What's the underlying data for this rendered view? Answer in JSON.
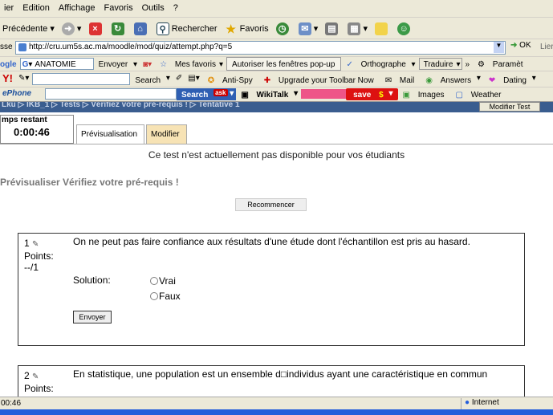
{
  "menu": [
    "ier",
    "Edition",
    "Affichage",
    "Favoris",
    "Outils",
    "?"
  ],
  "toolbar": {
    "back": "Précédente",
    "search": "Rechercher",
    "favorites": "Favoris"
  },
  "address": {
    "label": "sse",
    "url": "http://cru.um5s.ac.ma/moodle/mod/quiz/attempt.php?q=5",
    "go": "OK",
    "links": "Lier"
  },
  "google_bar": {
    "logo": "ogle",
    "search_value": "ANATOMIE",
    "send": "Envoyer",
    "bookmarks": "Mes favoris",
    "popups": "Autoriser les fenêtres pop-up",
    "spelling": "Orthographe",
    "translate": "Traduire",
    "settings": "Paramèt"
  },
  "yahoo_bar": {
    "logo": "Y!",
    "search": "Search",
    "antispy": "Anti-Spy",
    "upgrade": "Upgrade your Toolbar Now",
    "mail": "Mail",
    "answers": "Answers",
    "dating": "Dating"
  },
  "phone_bar": {
    "logo": "ePhone",
    "search": "Search",
    "wikitalk": "WikiTalk",
    "save": "save",
    "images": "Images",
    "weather": "Weather"
  },
  "page": {
    "breadcrumb": "Lku ▷ IKB_1 ▷ Tests ▷ Vérifiez votre pré-requis ! ▷ Tentative 1",
    "modify_test": "Modifier Test",
    "timer_label": "mps restant",
    "timer_value": "0:00:46",
    "tab_preview": "Prévisualisation",
    "tab_edit": "Modifier",
    "notice": "Ce test n'est actuellement pas disponible pour vos étudiants",
    "preview_title": "Prévisualiser Vérifiez votre pré-requis !",
    "restart": "Recommencer"
  },
  "questions": [
    {
      "num": "1",
      "points_label": "Points:",
      "points_value": "--/1",
      "text": "On ne peut pas faire confiance aux résultats d'une étude dont l'échantillon est pris au hasard.",
      "solution_label": "Solution:",
      "options": [
        "Vrai",
        "Faux"
      ],
      "submit": "Envoyer"
    },
    {
      "num": "2",
      "points_label": "Points:",
      "text": "En statistique, une population est un ensemble d□individus ayant une caractéristique en commun"
    }
  ],
  "status": {
    "left": "00:46",
    "zone": "Internet"
  }
}
